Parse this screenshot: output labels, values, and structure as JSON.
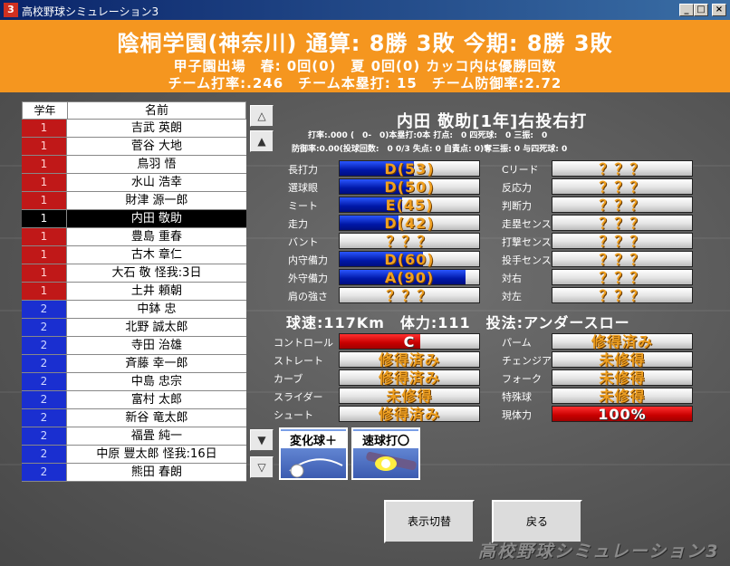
{
  "window": {
    "app_icon_text": "3",
    "title": "高校野球シミュレーション3",
    "minimize_glyph": "_",
    "maximize_glyph": "□",
    "close_glyph": "×"
  },
  "header": {
    "line1": "陰桐学園(神奈川) 通算: 8勝 3敗 今期: 8勝 3敗",
    "line2": "甲子園出場　春: 0回(0)　夏 0回(0) カッコ内は優勝回数",
    "line3": "チーム打率:.246　チーム本塁打: 15　チーム防御率:2.72"
  },
  "roster": {
    "header_year": "学年",
    "header_name": "名前",
    "players": [
      {
        "year": "1",
        "name": "吉武 英朗"
      },
      {
        "year": "1",
        "name": "菅谷 大地"
      },
      {
        "year": "1",
        "name": "鳥羽 悟"
      },
      {
        "year": "1",
        "name": "水山 浩幸"
      },
      {
        "year": "1",
        "name": "財津 源一郎"
      },
      {
        "year": "1",
        "name": "内田 敬助"
      },
      {
        "year": "1",
        "name": "豊島 重春"
      },
      {
        "year": "1",
        "name": "古木 章仁"
      },
      {
        "year": "1",
        "name": "大石 敬 怪我:3日"
      },
      {
        "year": "1",
        "name": "土井 頼朝"
      },
      {
        "year": "2",
        "name": "中鉢 忠"
      },
      {
        "year": "2",
        "name": "北野 誠太郎"
      },
      {
        "year": "2",
        "name": "寺田 治雄"
      },
      {
        "year": "2",
        "name": "斉藤 幸一郎"
      },
      {
        "year": "2",
        "name": "中島 忠宗"
      },
      {
        "year": "2",
        "name": "富村 太郎"
      },
      {
        "year": "2",
        "name": "新谷 竜太郎"
      },
      {
        "year": "2",
        "name": "福畳 純一"
      },
      {
        "year": "2",
        "name": "中原 豐太郎 怪我:16日"
      },
      {
        "year": "2",
        "name": "熊田 春朗"
      }
    ],
    "selected_index": 5
  },
  "scroll": {
    "page_up": "△",
    "line_up": "▲",
    "line_down": "▼",
    "page_down": "▽"
  },
  "player": {
    "title": "内田 敬助[1年]右投右打",
    "stats_line1": "打率:.000 (　0-　0)本塁打:0本 打点:　0 四死球:　0 三振:　0",
    "stats_line2": "防御率:0.00(投球回数:　0 0/3 失点: 0 自責点: 0)奪三振: 0 与四死球: 0"
  },
  "batting": [
    {
      "label": "長打力",
      "value": "D(53)",
      "level": 0.53
    },
    {
      "label": "選球眼",
      "value": "D(50)",
      "level": 0.5
    },
    {
      "label": "ミート",
      "value": "E(45)",
      "level": 0.45
    },
    {
      "label": "走力",
      "value": "D(42)",
      "level": 0.42
    },
    {
      "label": "バント",
      "value": "？？？",
      "level": 0
    },
    {
      "label": "内守備力",
      "value": "D(60)",
      "level": 0.6
    },
    {
      "label": "外守備力",
      "value": "A(90)",
      "level": 0.9
    },
    {
      "label": "肩の強さ",
      "value": "？？？",
      "level": 0
    }
  ],
  "fielding": [
    {
      "label": "Cリード",
      "value": "？？？"
    },
    {
      "label": "反応力",
      "value": "？？？"
    },
    {
      "label": "判断力",
      "value": "？？？"
    },
    {
      "label": "走塁センス",
      "value": "？？？"
    },
    {
      "label": "打撃センス",
      "value": "？？？"
    },
    {
      "label": "投手センス",
      "value": "？？？"
    },
    {
      "label": "対右",
      "value": "？？？"
    },
    {
      "label": "対左",
      "value": "？？？"
    }
  ],
  "pitching_summary": "球速:117Km　体力:111　投法:アンダースロー",
  "pitches": [
    {
      "label": "コントロール",
      "value": "C",
      "level": 0.58,
      "color": "red"
    },
    {
      "label": "ストレート",
      "value": "修得済み",
      "level": 0
    },
    {
      "label": "カーブ",
      "value": "修得済み",
      "level": 0
    },
    {
      "label": "スライダー",
      "value": "未修得",
      "level": 0
    },
    {
      "label": "シュート",
      "value": "修得済み",
      "level": 0
    }
  ],
  "pitches_right": [
    {
      "label": "パーム",
      "value": "修得済み",
      "level": 0
    },
    {
      "label": "チェンジアップ",
      "value": "未修得",
      "level": 0
    },
    {
      "label": "フォーク",
      "value": "未修得",
      "level": 0
    },
    {
      "label": "特殊球",
      "value": "未修得",
      "level": 0
    },
    {
      "label": "現体力",
      "value": "100%",
      "level": 1.0,
      "color": "red"
    }
  ],
  "badges": [
    {
      "label": "変化球＋"
    },
    {
      "label": "速球打〇"
    }
  ],
  "buttons": {
    "toggle_display": "表示切替",
    "back": "戻る"
  },
  "watermark": "高校野球シミュレーション3",
  "colors": {
    "header_orange": "#f5961f",
    "year1_red": "#c01818",
    "year2_blue": "#1a2fd0",
    "bar_blue": "#0018a8",
    "bar_red": "#c80000",
    "value_text": "#f0a020"
  }
}
